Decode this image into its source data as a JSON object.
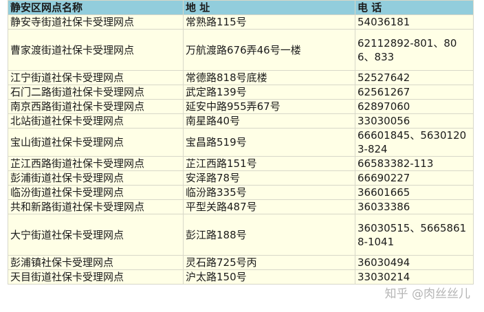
{
  "header": {
    "name": "静安区网点名称",
    "address": "地  址",
    "phone": "电  话"
  },
  "rows": [
    {
      "name": "静安寺街道社保卡受理网点",
      "address": "常熟路115号",
      "phone": "54036181"
    },
    {
      "name": "曹家渡街道社保卡受理网点",
      "address": "万航渡路676弄46号一楼",
      "phone": "62112892-801、806、833"
    },
    {
      "name": "江宁街道社保卡受理网点",
      "address": "常德路818号底楼",
      "phone": "52527642"
    },
    {
      "name": "石门二路街道社保卡受理网点",
      "address": "武定路139号",
      "phone": "62561267"
    },
    {
      "name": "南京西路街道社保卡受理网点",
      "address": "延安中路955弄67号",
      "phone": "62897060"
    },
    {
      "name": "北站街道社保卡受理网点",
      "address": "南星路40号",
      "phone": "33030056"
    },
    {
      "name": "宝山街道社保卡受理网点",
      "address": "宝昌路519号",
      "phone": "66601845、56301203-824"
    },
    {
      "name": "芷江西路街道社保卡受理网点",
      "address": "芷江西路151号",
      "phone": "66583382-113"
    },
    {
      "name": "彭浦街道社保卡受理网点",
      "address": "安泽路78号",
      "phone": "66690227"
    },
    {
      "name": "临汾街道社保卡受理网点",
      "address": "临汾路335号",
      "phone": "36601665"
    },
    {
      "name": "共和新路街道社保卡受理网点",
      "address": "平型关路487号",
      "phone": "36033386"
    },
    {
      "name": "大宁街道社保卡受理网点",
      "address": "彭江路188号",
      "phone": "36030515、56658618-1041"
    },
    {
      "name": "彭浦镇社保卡受理网点",
      "address": "灵石路725号丙",
      "phone": "36030494"
    },
    {
      "name": "天目街道社保卡受理网点",
      "address": "沪太路150号",
      "phone": "33030214"
    }
  ],
  "watermark": "知乎 @肉丝丝儿",
  "colors": {
    "header_bg": "#92cddc",
    "row_bg": "#ffffe6",
    "grid": "#d7d7c8"
  }
}
